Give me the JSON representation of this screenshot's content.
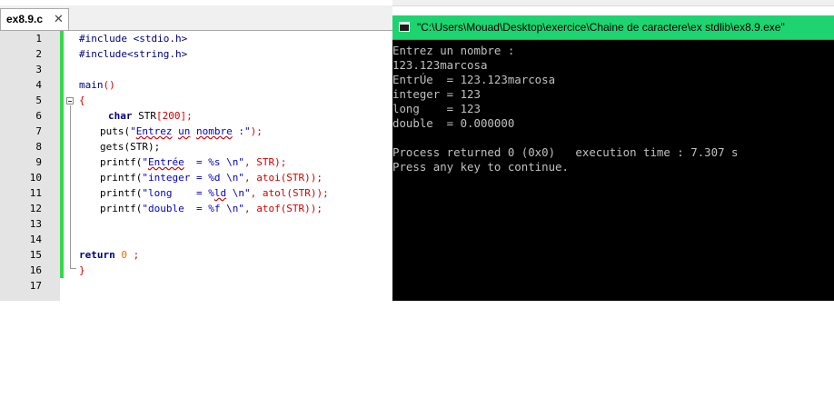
{
  "editor": {
    "tab": {
      "label": "ex8.9.c",
      "close_label": "✕"
    },
    "line_numbers": [
      "1",
      "2",
      "3",
      "4",
      "5",
      "6",
      "7",
      "8",
      "9",
      "10",
      "11",
      "12",
      "13",
      "14",
      "15",
      "16",
      "17"
    ],
    "code": {
      "l1": "#include <stdio.h>",
      "l2": "#include<string.h>",
      "l4_main": "main",
      "l4_paren": "()",
      "l5_brace": "{",
      "l6_type": "char",
      "l6_name": " STR",
      "l6_size": "[200];",
      "l7_fn": "puts(",
      "l7_q1": "\"",
      "l7_sq1": "Entrez",
      "l7_sp1": " ",
      "l7_sq2": "un",
      "l7_sp2": " ",
      "l7_sq3": "nombre",
      "l7_rest": " :\"",
      "l7_end": ");",
      "l8": "gets(STR);",
      "l9_fn": "printf(",
      "l9_q1": "\"",
      "l9_sq": "Entrée",
      "l9_str": "  = %s \\n\"",
      "l9_end": ", STR);",
      "l10_fn": "printf(",
      "l10_str": "\"integer = %d \\n\"",
      "l10_end": ", atoi(STR));",
      "l11_fn": "printf(",
      "l11_str1": "\"long    = %",
      "l11_sq": "ld",
      "l11_str2": " \\n\"",
      "l11_end": ", atol(STR));",
      "l12_fn": "printf(",
      "l12_str": "\"double  = %f \\n\"",
      "l12_end": ", atof(STR));",
      "l15_kw": "return",
      "l15_num": " 0",
      "l15_end": " ;",
      "l16_brace": "}"
    }
  },
  "console": {
    "title": "\"C:\\Users\\Mouad\\Desktop\\exercice\\Chaine de caractere\\ex stdlib\\ex8.9.exe\"",
    "lines": [
      "Entrez un nombre :",
      "123.123marcosa",
      "EntrÚe  = 123.123marcosa",
      "integer = 123",
      "long    = 123",
      "double  = 0.000000",
      "",
      "Process returned 0 (0x0)   execution time : 7.307 s",
      "Press any key to continue."
    ]
  },
  "colors": {
    "console_title_bg": "#1dd471",
    "console_bg": "#000000",
    "console_text": "#c0c0c0",
    "change_bar": "#34d84c",
    "gutter_bg": "#e4e4e4"
  },
  "icons": {
    "console_window": "console-window-icon",
    "tab_close": "close-icon",
    "fold": "fold-minus-icon"
  }
}
